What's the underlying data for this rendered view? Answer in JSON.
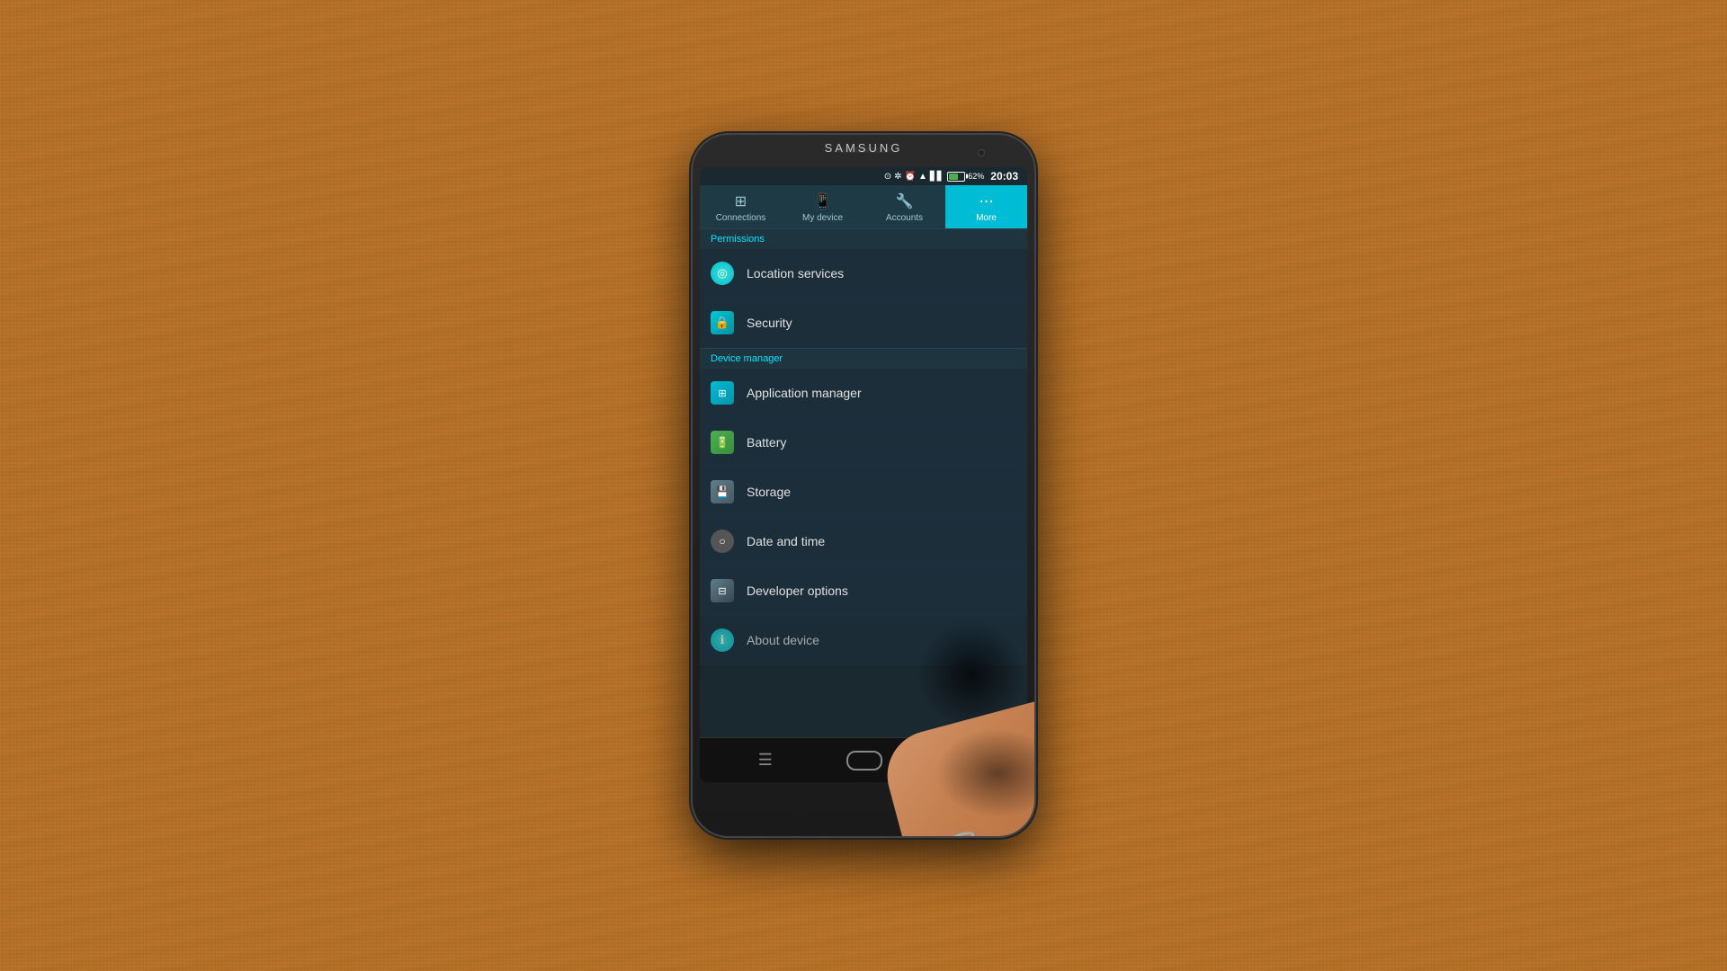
{
  "phone": {
    "brand": "SAMSUNG",
    "statusBar": {
      "time": "20:03",
      "batteryPercent": "62%",
      "icons": [
        "⊙",
        "✲",
        "⏰",
        "▲",
        "▋▋"
      ]
    },
    "tabs": [
      {
        "label": "Connections",
        "icon": "⊞",
        "active": false
      },
      {
        "label": "My device",
        "icon": "📱",
        "active": false
      },
      {
        "label": "Accounts",
        "icon": "🔧",
        "active": false
      },
      {
        "label": "More",
        "icon": "⋯",
        "active": true
      }
    ],
    "sections": [
      {
        "header": "Permissions",
        "items": [
          {
            "label": "Location services",
            "iconType": "location",
            "icon": "◎"
          },
          {
            "label": "Security",
            "iconType": "security",
            "icon": "🔒"
          }
        ]
      },
      {
        "header": "Device manager",
        "items": [
          {
            "label": "Application manager",
            "iconType": "app",
            "icon": "⊞"
          },
          {
            "label": "Battery",
            "iconType": "battery",
            "icon": "🔋"
          },
          {
            "label": "Storage",
            "iconType": "storage",
            "icon": "💾"
          },
          {
            "label": "Date and time",
            "iconType": "date",
            "icon": "○"
          },
          {
            "label": "Developer options",
            "iconType": "dev",
            "icon": "⊟"
          },
          {
            "label": "About device",
            "iconType": "about",
            "icon": "ℹ"
          }
        ]
      }
    ],
    "bottomNav": {
      "menu": "☰",
      "back": "↩"
    }
  }
}
